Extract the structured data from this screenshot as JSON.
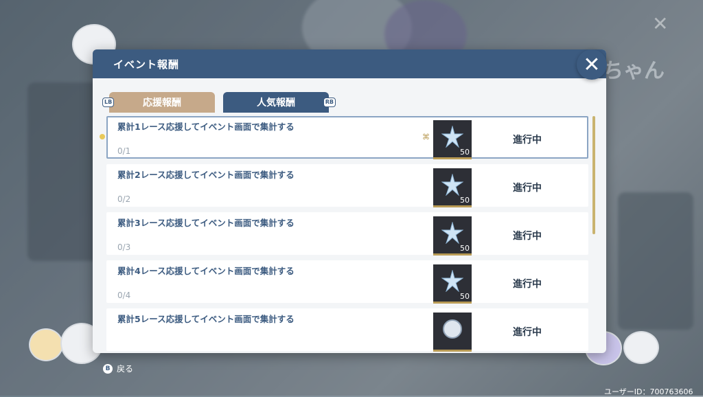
{
  "background": {
    "right_title": "子ちゃん"
  },
  "modal": {
    "title": "イベント報酬",
    "close_icon": "close-icon"
  },
  "tabs": [
    {
      "label": "応援報酬",
      "hint": "LB"
    },
    {
      "label": "人気報酬",
      "hint": "RB"
    }
  ],
  "rewards": [
    {
      "text": "累計1レース応援してイベント画面で集計する",
      "progress": "0/1",
      "count": "50",
      "status": "進行中"
    },
    {
      "text": "累計2レース応援してイベント画面で集計する",
      "progress": "0/2",
      "count": "50",
      "status": "進行中"
    },
    {
      "text": "累計3レース応援してイベント画面で集計する",
      "progress": "0/3",
      "count": "50",
      "status": "進行中"
    },
    {
      "text": "累計4レース応援してイベント画面で集計する",
      "progress": "0/4",
      "count": "50",
      "status": "進行中"
    },
    {
      "text": "累計5レース応援してイベント画面で集計する",
      "progress": "",
      "count": "",
      "status": "進行中"
    }
  ],
  "footer": {
    "back_key": "B",
    "back_label": "戻る",
    "user_id": "ユーザーID：700763606"
  }
}
